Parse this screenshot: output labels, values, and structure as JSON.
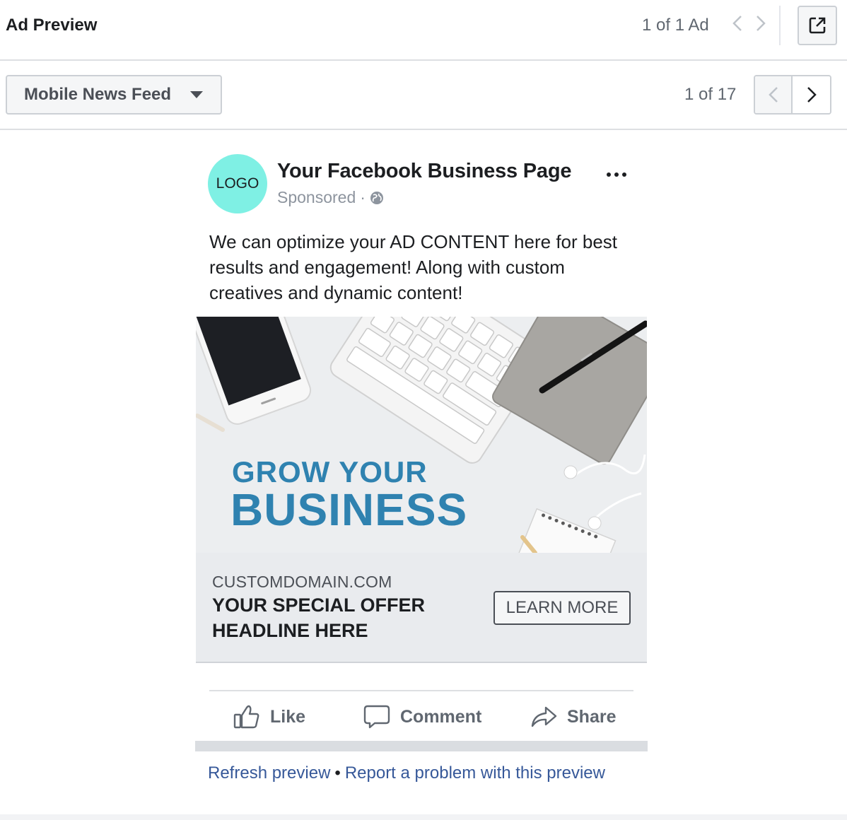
{
  "header": {
    "title": "Ad Preview",
    "ad_counter": "1 of 1 Ad"
  },
  "placement": {
    "selected": "Mobile News Feed",
    "counter": "1 of 17"
  },
  "post": {
    "logo_text": "LOGO",
    "page_name": "Your Facebook Business Page",
    "sponsored": "Sponsored",
    "separator": "·",
    "body": "We can optimize your AD CONTENT here for best results and engagement! Along with custom creatives and dynamic content!",
    "creative": {
      "headline_line1": "GROW YOUR",
      "headline_line2": "BUSINESS",
      "accent_color": "#2f82b0"
    },
    "link": {
      "domain": "CUSTOMDOMAIN.COM",
      "headline": "YOUR SPECIAL OFFER HEADLINE HERE",
      "cta": "LEARN MORE"
    },
    "actions": {
      "like": "Like",
      "comment": "Comment",
      "share": "Share"
    }
  },
  "footer": {
    "refresh": "Refresh preview",
    "bullet": "•",
    "report": "Report a problem with this preview"
  },
  "icons": {
    "external": "external-link-icon",
    "prev": "chevron-left-icon",
    "next": "chevron-right-icon",
    "caret": "caret-down-icon",
    "globe": "globe-icon",
    "more": "more-icon",
    "like": "thumbs-up-icon",
    "comment": "comment-icon",
    "share": "share-icon"
  },
  "colors": {
    "logo_bg": "#7ff0e4",
    "link_blue": "#365899"
  }
}
